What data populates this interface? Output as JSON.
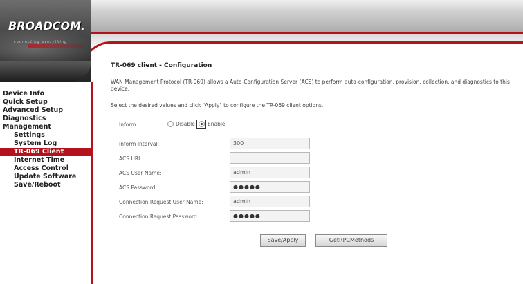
{
  "header": {
    "brand": "BROADCOM.",
    "tagline": "connecting everything"
  },
  "sidebar": {
    "items": [
      {
        "label": "Device Info",
        "level": 1,
        "active": false
      },
      {
        "label": "Quick Setup",
        "level": 1,
        "active": false
      },
      {
        "label": "Advanced Setup",
        "level": 1,
        "active": false
      },
      {
        "label": "Diagnostics",
        "level": 1,
        "active": false
      },
      {
        "label": "Management",
        "level": 1,
        "active": false
      },
      {
        "label": "Settings",
        "level": 2,
        "active": false
      },
      {
        "label": "System Log",
        "level": 2,
        "active": false
      },
      {
        "label": "TR-069 Client",
        "level": 2,
        "active": true
      },
      {
        "label": "Internet Time",
        "level": 2,
        "active": false
      },
      {
        "label": "Access Control",
        "level": 2,
        "active": false
      },
      {
        "label": "Update Software",
        "level": 2,
        "active": false
      },
      {
        "label": "Save/Reboot",
        "level": 2,
        "active": false
      }
    ]
  },
  "main": {
    "title": "TR-069 client - Configuration",
    "description": "WAN Management Protocol (TR-069) allows a Auto-Configuration Server (ACS) to perform auto-configuration, provision, collection, and diagnostics to this device.",
    "instruction": "Select the desired values and click \"Apply\" to configure the TR-069 client options.",
    "inform": {
      "label": "Inform",
      "disable_label": "Disable",
      "enable_label": "Enable",
      "selected": "Enable"
    },
    "fields": [
      {
        "name": "inform-interval",
        "label": "Inform Interval:",
        "value": "300",
        "type": "text"
      },
      {
        "name": "acs-url",
        "label": "ACS URL:",
        "value": "",
        "type": "text"
      },
      {
        "name": "acs-user-name",
        "label": "ACS User Name:",
        "value": "admin",
        "type": "text"
      },
      {
        "name": "acs-password",
        "label": "ACS Password:",
        "value": "●●●●●",
        "type": "password"
      },
      {
        "name": "connection-request-user-name",
        "label": "Connection Request User Name:",
        "value": "admin",
        "type": "text"
      },
      {
        "name": "connection-request-password",
        "label": "Connection Request Password:",
        "value": "●●●●●",
        "type": "password"
      }
    ],
    "buttons": {
      "save_apply": "Save/Apply",
      "get_rpc_methods": "GetRPCMethods"
    }
  }
}
